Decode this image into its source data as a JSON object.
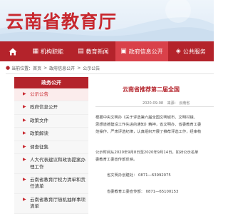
{
  "site": {
    "title": "云南省教育厅"
  },
  "nav": {
    "items": [
      {
        "label": "机构职能",
        "icon": "building-icon"
      },
      {
        "label": "教育新闻",
        "icon": "newspaper-icon"
      },
      {
        "label": "政府信息公开",
        "icon": "document-icon",
        "active": true
      },
      {
        "label": "公共服务",
        "icon": "service-icon"
      }
    ]
  },
  "breadcrumb": {
    "prefix": "当前位置：",
    "items": [
      "首页",
      "政府信息公开",
      "公示公告"
    ],
    "separator": ">"
  },
  "sidebar": {
    "heading": "政务公开",
    "items": [
      {
        "label": "公示公告",
        "active": true
      },
      {
        "label": "政府信息公开"
      },
      {
        "label": "政策文件"
      },
      {
        "label": "政策解读"
      },
      {
        "label": "调查征集"
      },
      {
        "label": "人大代表建议和政协提案办理工作"
      },
      {
        "label": "云南省教育厅权力清单和责任清单"
      },
      {
        "label": "云南省教育厅随机抽样事项清单"
      }
    ]
  },
  "article": {
    "title": "云南省推荐第二届全国",
    "date": "2020-09-08",
    "date_label": "来源：",
    "source": "云南省",
    "paragraph1": [
      "根据中央文明办《关于评选第六届全国文明城市、文明村镇、",
      "思想道德建设工作先进的通知》精神，省文明办、省委教育工委",
      "范操作、严肃评选纪律，认真组织开展了推荐评选工作，经审核"
    ],
    "paragraph2": [
      "公示时间从2020年9月8日至2020年9月14日。如对公示名单",
      "委教育工委宣传部反映。"
    ],
    "contact1": "省文明办创建处：  0871—63992075",
    "contact2": "省委教育工委宣传部：  0871—65100153"
  }
}
